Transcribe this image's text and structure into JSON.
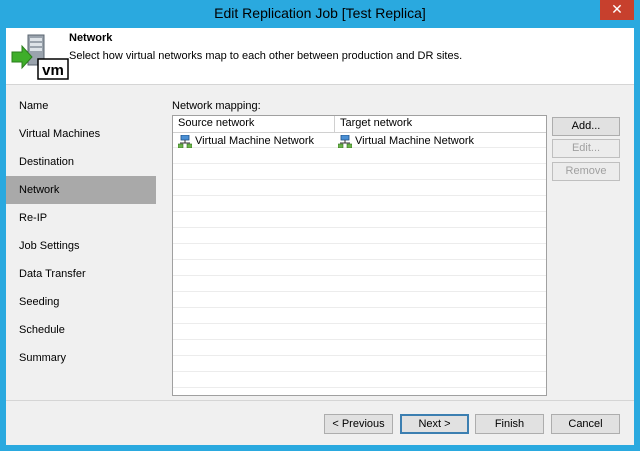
{
  "window": {
    "title": "Edit Replication Job [Test Replica]",
    "close_glyph": "✕"
  },
  "header": {
    "title": "Network",
    "subtitle": "Select how virtual networks map to each other between production and DR sites.",
    "icon": "vm-import-icon"
  },
  "nav": {
    "items": [
      {
        "label": "Name"
      },
      {
        "label": "Virtual Machines"
      },
      {
        "label": "Destination"
      },
      {
        "label": "Network",
        "active": true
      },
      {
        "label": "Re-IP"
      },
      {
        "label": "Job Settings"
      },
      {
        "label": "Data Transfer"
      },
      {
        "label": "Seeding"
      },
      {
        "label": "Schedule"
      },
      {
        "label": "Summary"
      }
    ]
  },
  "mapping": {
    "label": "Network mapping:",
    "columns": [
      "Source network",
      "Target network"
    ],
    "rows": [
      {
        "source": "Virtual Machine Network",
        "target": "Virtual Machine Network"
      }
    ]
  },
  "side_buttons": {
    "add": "Add...",
    "edit": "Edit...",
    "remove": "Remove"
  },
  "footer": {
    "previous": "< Previous",
    "next": "Next >",
    "finish": "Finish",
    "cancel": "Cancel"
  },
  "colors": {
    "titlebar": "#2aa9df",
    "close": "#c7402d",
    "nav_active": "#a9a9a9"
  }
}
